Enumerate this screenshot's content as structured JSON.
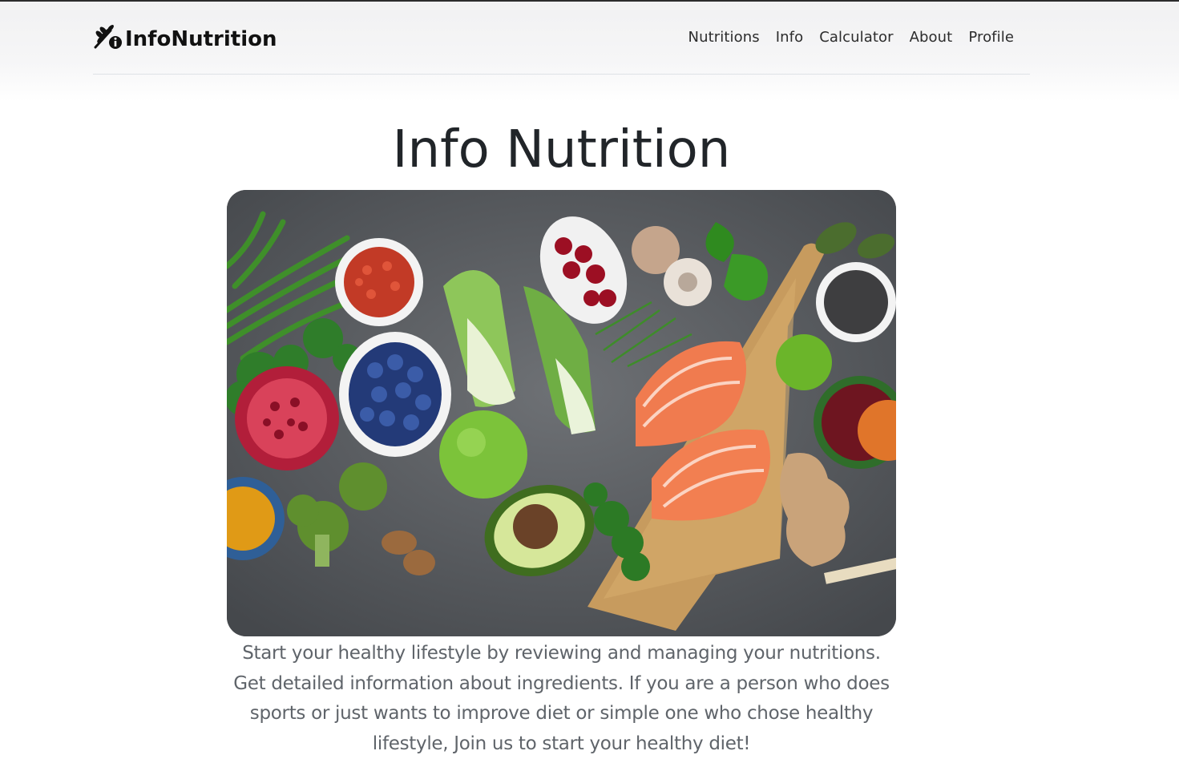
{
  "header": {
    "brand_name": "InfoNutrition",
    "brand_icon": "wheat-info-icon",
    "nav": [
      {
        "label": "Nutritions"
      },
      {
        "label": "Info"
      },
      {
        "label": "Calculator"
      },
      {
        "label": "About"
      },
      {
        "label": "Profile"
      }
    ]
  },
  "main": {
    "title": "Info Nutrition",
    "hero_image": "healthy-food-flatlay",
    "description": "Start your healthy lifestyle by reviewing and managing your nutritions. Get detailed information about ingredients. If you are a person who does sports or just wants to improve diet or simple one who chose healthy lifestyle, Join us to start your healthy diet!"
  },
  "colors": {
    "text": "#212529",
    "muted": "#5f646a",
    "header_bg": "#f1f1f2"
  }
}
